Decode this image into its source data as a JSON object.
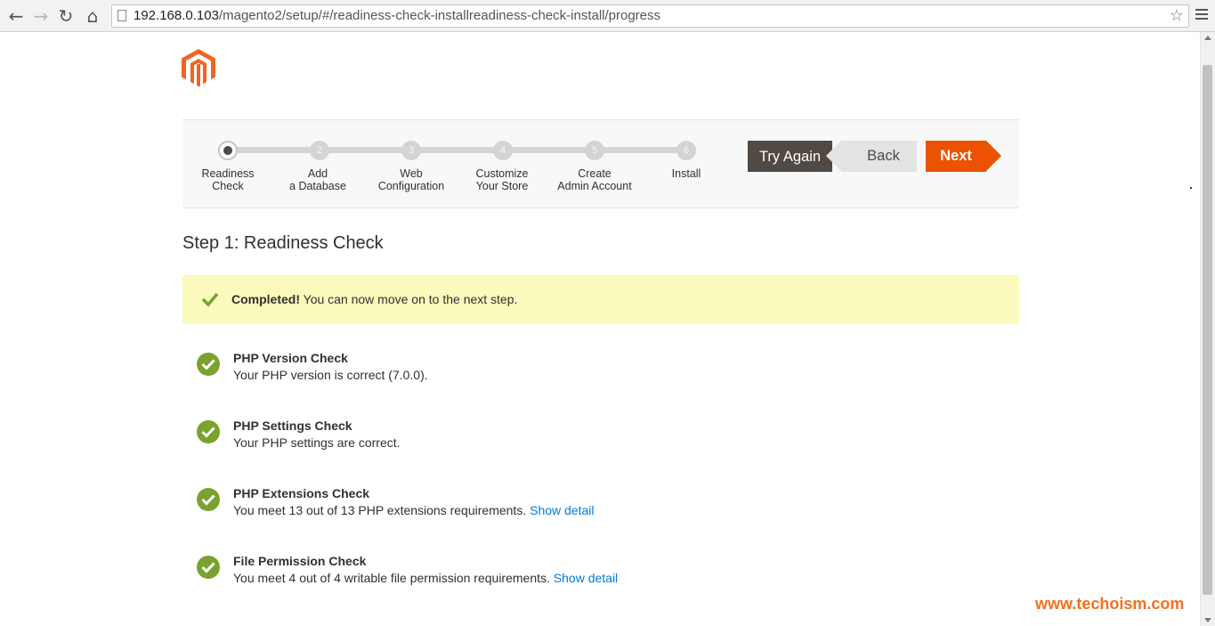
{
  "browser": {
    "url_host": "192.168.0.103",
    "url_path": "/magento2/setup/#/readiness-check-installreadiness-check-install/progress"
  },
  "wizard": {
    "steps": [
      {
        "number": "1",
        "label": "Readiness\nCheck",
        "state": "active"
      },
      {
        "number": "2",
        "label": "Add\na Database",
        "state": "pending"
      },
      {
        "number": "3",
        "label": "Web\nConfiguration",
        "state": "pending"
      },
      {
        "number": "4",
        "label": "Customize\nYour Store",
        "state": "pending"
      },
      {
        "number": "5",
        "label": "Create\nAdmin Account",
        "state": "pending"
      },
      {
        "number": "6",
        "label": "Install",
        "state": "pending"
      }
    ],
    "buttons": {
      "try_again": "Try Again",
      "back": "Back",
      "next": "Next"
    }
  },
  "page": {
    "title": "Step 1: Readiness Check",
    "success": {
      "strong": "Completed!",
      "text": " You can now move on to the next step."
    },
    "checks": [
      {
        "title": "PHP Version Check",
        "desc": "Your PHP version is correct (7.0.0).",
        "link": ""
      },
      {
        "title": "PHP Settings Check",
        "desc": "Your PHP settings are correct.",
        "link": ""
      },
      {
        "title": "PHP Extensions Check",
        "desc": "You meet 13 out of 13 PHP extensions requirements.",
        "link": "Show detail"
      },
      {
        "title": "File Permission Check",
        "desc": "You meet 4 out of 4 writable file permission requirements.",
        "link": "Show detail"
      }
    ]
  },
  "watermark": "www.techoism.com",
  "colors": {
    "brand_orange": "#eb5202",
    "dark_button": "#514943",
    "success_green": "#79a22e",
    "notice_yellow": "#fafabc",
    "link_blue": "#007bdb"
  }
}
